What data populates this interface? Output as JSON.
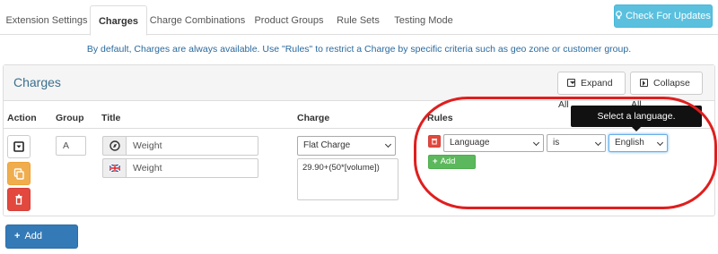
{
  "tabs": [
    {
      "label": "Extension Settings"
    },
    {
      "label": "Charges"
    },
    {
      "label": "Charge Combinations"
    },
    {
      "label": "Product Groups"
    },
    {
      "label": "Rule Sets"
    },
    {
      "label": "Testing Mode"
    }
  ],
  "header": {
    "check_updates_label": "Check For Updates"
  },
  "info_text": "By default, Charges are always available. Use \"Rules\" to restrict a Charge by specific criteria such as geo zone or customer group.",
  "panel": {
    "title": "Charges",
    "expand_all_label": "Expand All",
    "collapse_all_label": "Collapse All"
  },
  "columns": {
    "action": "Action",
    "group": "Group",
    "title": "Title",
    "charge": "Charge",
    "rules": "Rules"
  },
  "row": {
    "group_value": "A",
    "title_default": "Weight",
    "title_english": "Weight",
    "charge_type": "Flat Charge",
    "charge_formula": "29.90+(50*[volume])"
  },
  "rule": {
    "type": "Language",
    "operator": "is",
    "value": "English",
    "add_rule_label": "Add Rule"
  },
  "tooltip": "Select a language.",
  "footer": {
    "add_charge_label": "Add Charge"
  },
  "colors": {
    "primary": "#337ab7",
    "info": "#5bc0de",
    "success": "#5cb85c",
    "warning": "#f0ad4e",
    "danger": "#e2483d",
    "highlight": "#e01e1e"
  }
}
